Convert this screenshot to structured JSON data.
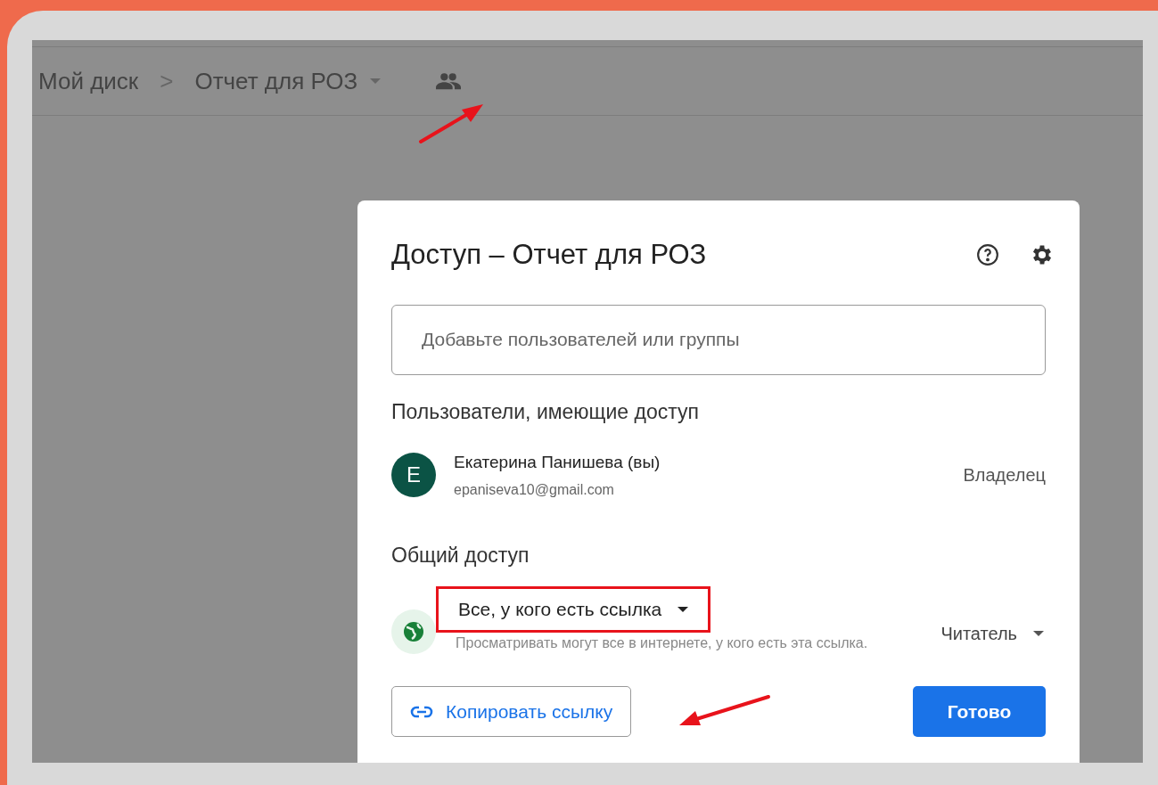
{
  "breadcrumb": {
    "root": "Мой диск",
    "separator": ">",
    "folder": "Отчет для РОЗ"
  },
  "dialog": {
    "title": "Доступ – Отчет для РОЗ",
    "search": {
      "placeholder": "Добавьте пользователей или группы"
    },
    "people_heading": "Пользователи, имеющие доступ",
    "people": [
      {
        "initial": "E",
        "name": "Екатерина Панишева (вы)",
        "email": "epaniseva10@gmail.com",
        "role": "Владелец",
        "color": "#0b5345"
      }
    ],
    "general_heading": "Общий доступ",
    "general": {
      "option": "Все, у кого есть ссылка",
      "highlighted": true,
      "description": "Просматривать могут все в интернете, у кого есть эта ссылка.",
      "role": "Читатель"
    },
    "copy_link": "Копировать ссылку",
    "done": "Готово"
  }
}
